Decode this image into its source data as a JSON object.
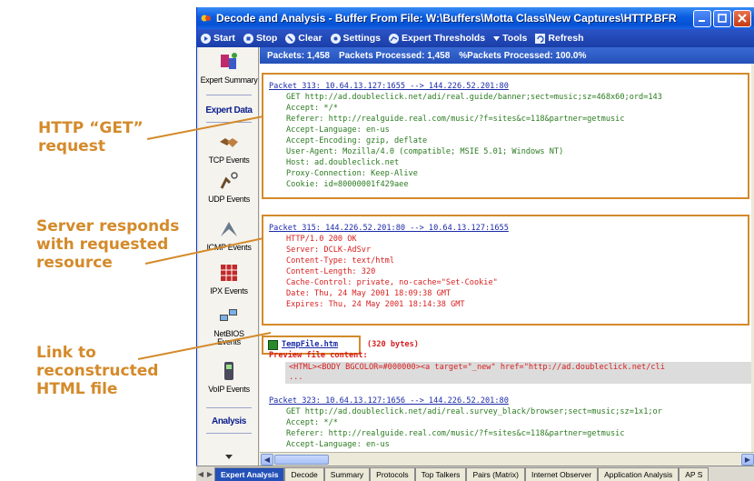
{
  "annotations": {
    "get_request": [
      "HTTP “GET”",
      "request"
    ],
    "server_response": [
      "Server responds",
      "with requested",
      "resource"
    ],
    "link": [
      "Link to",
      "reconstructed",
      "HTML file"
    ]
  },
  "window": {
    "title": "Decode and Analysis - Buffer From File:  W:\\Buffers\\Motta Class\\New Captures\\HTTP.BFR"
  },
  "toolbar": {
    "start": "Start",
    "stop": "Stop",
    "clear": "Clear",
    "settings": "Settings",
    "expert_thresholds": "Expert Thresholds",
    "tools": "Tools",
    "refresh": "Refresh"
  },
  "status": {
    "packets": "Packets: 1,458",
    "processed": "Packets Processed: 1,458",
    "percent": "%Packets Processed: 100.0%"
  },
  "sidebar": {
    "expert_summary": "Expert Summary",
    "expert_data": "Expert Data",
    "tcp": "TCP Events",
    "udp": "UDP Events",
    "icmp": "ICMP Events",
    "ipx": "IPX Events",
    "netbios": "NetBIOS Events",
    "voip": "VoIP Events",
    "analysis": "Analysis"
  },
  "packets": {
    "p313": {
      "header": "Packet 313: 10.64.13.127:1655 --> 144.226.52.201:80",
      "lines": [
        "GET http://ad.doubleclick.net/adi/real.guide/banner;sect=music;sz=468x60;ord=143",
        "Accept: */*",
        "Referer: http://realguide.real.com/music/?f=sites&c=118&partner=getmusic",
        "Accept-Language: en-us",
        "Accept-Encoding: gzip, deflate",
        "User-Agent: Mozilla/4.0 (compatible; MSIE 5.01; Windows NT)",
        "Host: ad.doubleclick.net",
        "Proxy-Connection: Keep-Alive",
        "Cookie: id=80000001f429aee"
      ]
    },
    "p315": {
      "header": "Packet 315: 144.226.52.201:80 --> 10.64.13.127:1655",
      "lines": [
        "HTTP/1.0 200 OK",
        "Server: DCLK-AdSvr",
        "Content-Type: text/html",
        "Content-Length: 320",
        "Cache-Control: private, no-cache=\"Set-Cookie\"",
        "Date: Thu, 24 May 2001 18:09:38 GMT",
        "Expires: Thu, 24 May 2001 18:14:38 GMT"
      ]
    },
    "file": {
      "name": "TempFile.htm",
      "size": "(320 bytes)",
      "preview_label": "Preview file content:",
      "preview_line": "<HTML><BODY BGCOLOR=#000000><a target=\"_new\" href=\"http://ad.doubleclick.net/cli",
      "ellipsis": "..."
    },
    "p323": {
      "header": "Packet 323: 10.64.13.127:1656 --> 144.226.52.201:80",
      "lines": [
        "GET http://ad.doubleclick.net/adi/real.survey_black/browser;sect=music;sz=1x1;or",
        "Accept: */*",
        "Referer: http://realguide.real.com/music/?f=sites&c=118&partner=getmusic",
        "Accept-Language: en-us"
      ]
    }
  },
  "tabs": [
    "Expert Analysis",
    "Decode",
    "Summary",
    "Protocols",
    "Top Talkers",
    "Pairs (Matrix)",
    "Internet Observer",
    "Application Analysis",
    "AP S"
  ],
  "colors": {
    "annotation": "#d48a2a",
    "link": "#1c2ba8",
    "request_text": "#2a7a1f",
    "response_text": "#d81e1e"
  }
}
